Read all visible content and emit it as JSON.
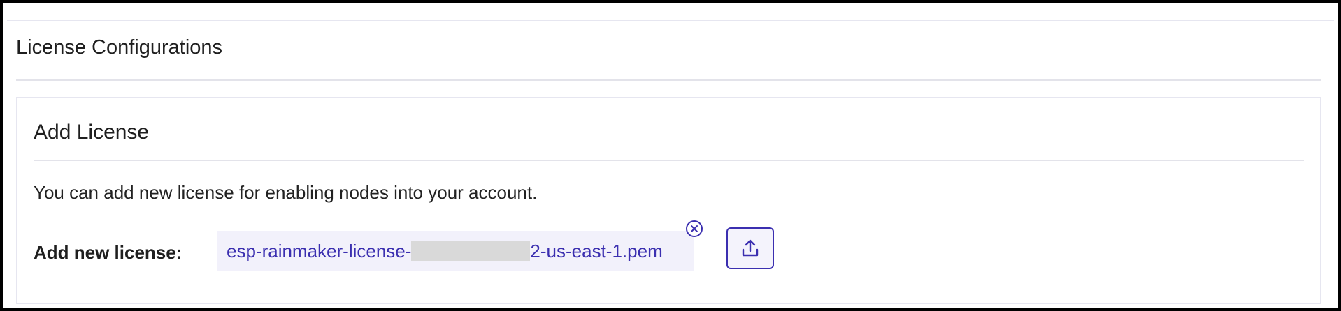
{
  "section": {
    "title": "License Configurations"
  },
  "add_license": {
    "title": "Add License",
    "description": "You can add new license for enabling nodes into your account.",
    "field_label": "Add new license:",
    "file": {
      "name_prefix": "esp-rainmaker-license-",
      "name_suffix": "2-us-east-1.pem"
    },
    "remove_icon": "close-circle-icon",
    "upload_icon": "upload-icon"
  },
  "colors": {
    "accent": "#3b2fb0",
    "chip_bg": "#f2f1fb",
    "border": "#e6e6f0"
  }
}
